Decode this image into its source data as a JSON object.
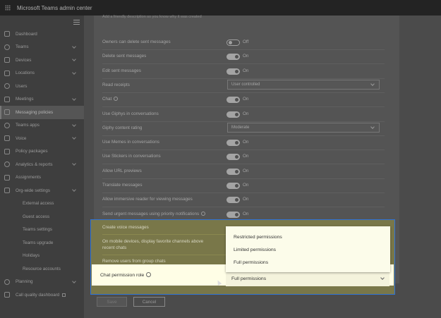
{
  "app": {
    "title": "Microsoft Teams admin center"
  },
  "nav": {
    "items": [
      {
        "label": "Dashboard",
        "icon": "home-icon",
        "chevron": false,
        "sub": false,
        "selected": false
      },
      {
        "label": "Teams",
        "icon": "teams-icon",
        "chevron": true,
        "sub": false,
        "selected": false
      },
      {
        "label": "Devices",
        "icon": "devices-icon",
        "chevron": true,
        "sub": false,
        "selected": false
      },
      {
        "label": "Locations",
        "icon": "globe-icon",
        "chevron": true,
        "sub": false,
        "selected": false
      },
      {
        "label": "Users",
        "icon": "users-icon",
        "chevron": false,
        "sub": false,
        "selected": false
      },
      {
        "label": "Meetings",
        "icon": "calendar-icon",
        "chevron": true,
        "sub": false,
        "selected": false
      },
      {
        "label": "Messaging policies",
        "icon": "chat-icon",
        "chevron": false,
        "sub": false,
        "selected": true
      },
      {
        "label": "Teams apps",
        "icon": "apps-icon",
        "chevron": true,
        "sub": false,
        "selected": false
      },
      {
        "label": "Voice",
        "icon": "phone-icon",
        "chevron": true,
        "sub": false,
        "selected": false
      },
      {
        "label": "Policy packages",
        "icon": "package-icon",
        "chevron": false,
        "sub": false,
        "selected": false
      },
      {
        "label": "Analytics & reports",
        "icon": "chart-icon",
        "chevron": true,
        "sub": false,
        "selected": false
      },
      {
        "label": "Assignments",
        "icon": "list-icon",
        "chevron": false,
        "sub": false,
        "selected": false
      },
      {
        "label": "Org-wide settings",
        "icon": "gear-icon",
        "chevron": true,
        "sub": false,
        "selected": false
      },
      {
        "label": "External access",
        "icon": "",
        "chevron": false,
        "sub": true,
        "selected": false
      },
      {
        "label": "Guest access",
        "icon": "",
        "chevron": false,
        "sub": true,
        "selected": false
      },
      {
        "label": "Teams settings",
        "icon": "",
        "chevron": false,
        "sub": true,
        "selected": false
      },
      {
        "label": "Teams upgrade",
        "icon": "",
        "chevron": false,
        "sub": true,
        "selected": false
      },
      {
        "label": "Holidays",
        "icon": "",
        "chevron": false,
        "sub": true,
        "selected": false
      },
      {
        "label": "Resource accounts",
        "icon": "",
        "chevron": false,
        "sub": true,
        "selected": false
      },
      {
        "label": "Planning",
        "icon": "planning-icon",
        "chevron": true,
        "sub": false,
        "selected": false
      },
      {
        "label": "Call quality dashboard",
        "icon": "quality-icon",
        "chevron": false,
        "sub": false,
        "selected": false
      }
    ]
  },
  "main": {
    "top_note": "Add a friendly description so you know why it was created",
    "settings": [
      {
        "label": "Owners can delete sent messages",
        "type": "toggle",
        "on": false,
        "state": "Off"
      },
      {
        "label": "Delete sent messages",
        "type": "toggle",
        "on": true,
        "state": "On"
      },
      {
        "label": "Edit sent messages",
        "type": "toggle",
        "on": true,
        "state": "On"
      },
      {
        "label": "Read receipts",
        "type": "dropdown",
        "value": "User controlled"
      },
      {
        "label": "Chat",
        "type": "toggle",
        "on": true,
        "state": "On",
        "info": true
      },
      {
        "label": "Use Giphys in conversations",
        "type": "toggle",
        "on": true,
        "state": "On"
      },
      {
        "label": "Giphy content rating",
        "type": "dropdown",
        "value": "Moderate"
      },
      {
        "label": "Use Memes in conversations",
        "type": "toggle",
        "on": true,
        "state": "On"
      },
      {
        "label": "Use Stickers in conversations",
        "type": "toggle",
        "on": true,
        "state": "On"
      },
      {
        "label": "Allow URL previews",
        "type": "toggle",
        "on": true,
        "state": "On"
      },
      {
        "label": "Translate messages",
        "type": "toggle",
        "on": true,
        "state": "On"
      },
      {
        "label": "Allow immersive reader for viewing messages",
        "type": "toggle",
        "on": true,
        "state": "On"
      },
      {
        "label": "Send urgent messages using priority notifications",
        "type": "toggle",
        "on": true,
        "state": "On",
        "info": true
      }
    ],
    "highlight": {
      "create_voice_messages": "Create voice messages",
      "mobile_favorites_line1": "On mobile devices, display favorite channels above",
      "mobile_favorites_line2": "recent chats",
      "remove_users": "Remove users from group chats",
      "chat_permission_label": "Chat permission role",
      "chat_permission_value": "Full permissions",
      "options": [
        "Restricted permissions",
        "Limited permissions",
        "Full permissions"
      ]
    },
    "buttons": {
      "save": "Save",
      "cancel": "Cancel"
    }
  },
  "colors": {
    "highlight_border": "#2f73d6"
  }
}
